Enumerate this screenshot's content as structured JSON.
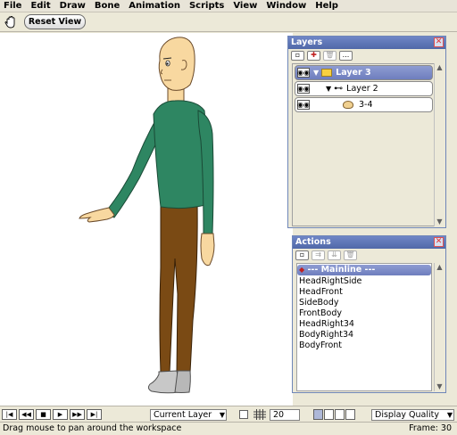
{
  "menubar": {
    "items": [
      "File",
      "Edit",
      "Draw",
      "Bone",
      "Animation",
      "Scripts",
      "View",
      "Window",
      "Help"
    ]
  },
  "toolbar": {
    "reset_view_label": "Reset View",
    "hand_icon": "hand-icon"
  },
  "layers_panel": {
    "title": "Layers",
    "close_label": "✕",
    "tools": [
      "new-layer-icon",
      "add-layer-icon",
      "delete-layer-icon",
      "more-icon"
    ],
    "more_label": "...",
    "rows": [
      {
        "label": "Layer 3",
        "icon": "folder-icon",
        "selected": true
      },
      {
        "label": "Layer 2",
        "icon": "bone-icon",
        "selected": false
      },
      {
        "label": "3-4",
        "icon": "vector-icon",
        "selected": false
      }
    ]
  },
  "actions_panel": {
    "title": "Actions",
    "close_label": "✕",
    "tools": [
      "new-action-icon",
      "duplicate-action-icon",
      "insert-action-icon",
      "delete-action-icon"
    ],
    "items": [
      {
        "label": "--- Mainline ---",
        "selected": true
      },
      {
        "label": "HeadRightSide",
        "selected": false
      },
      {
        "label": "HeadFront",
        "selected": false
      },
      {
        "label": "SideBody",
        "selected": false
      },
      {
        "label": "FrontBody",
        "selected": false
      },
      {
        "label": "HeadRight34",
        "selected": false
      },
      {
        "label": "BodyRight34",
        "selected": false
      },
      {
        "label": "BodyFront",
        "selected": false
      }
    ]
  },
  "timeline": {
    "playback_buttons": [
      "rewind-icon",
      "step-back-icon",
      "stop-icon",
      "play-icon",
      "step-forward-icon",
      "fast-forward-icon"
    ],
    "layer_mode": "Current Layer",
    "grid_size": "20",
    "display_quality": "Display Quality"
  },
  "status": {
    "message": "Drag mouse to pan around the workspace",
    "frame": "Frame: 30"
  },
  "colors": {
    "shirt": "#2E8662",
    "pants": "#7A4A14",
    "skin": "#F8D8A0",
    "shoe": "#C8C8C8",
    "panel_title": "#5D75B8",
    "selection": "#7E8EC8"
  }
}
